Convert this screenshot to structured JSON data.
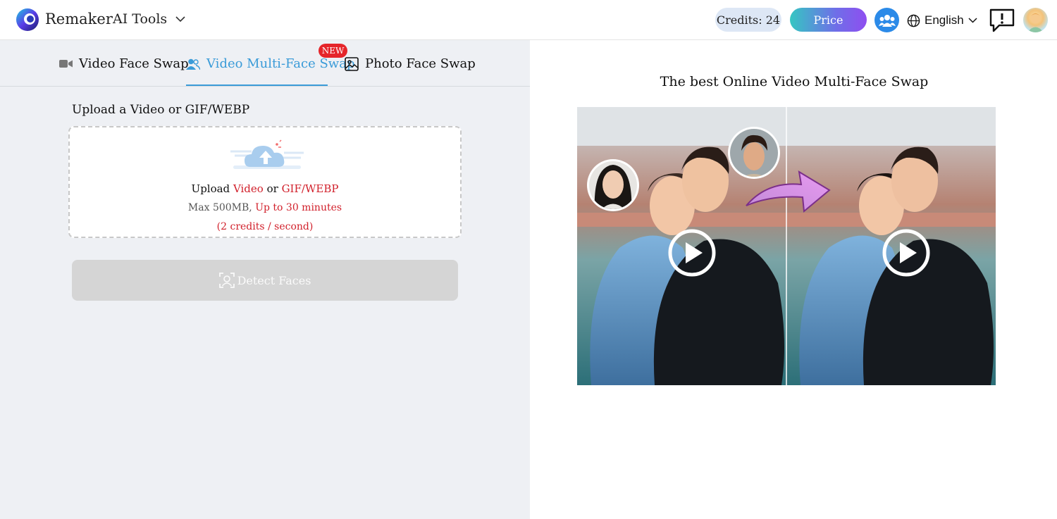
{
  "header": {
    "brand": "Remaker",
    "tools_label": "AI Tools",
    "credits_label": "Credits: 24",
    "price_label": "Price",
    "language": "English"
  },
  "tabs": [
    {
      "label": "Video Face Swap",
      "icon": "video-camera-icon"
    },
    {
      "label": "Video Multi-Face Swap",
      "icon": "users-icon",
      "active": true,
      "badge": "NEW"
    },
    {
      "label": "Photo Face Swap",
      "icon": "image-icon"
    }
  ],
  "upload": {
    "title": "Upload a Video or GIF/WEBP",
    "line1_prefix": "Upload ",
    "line1_video": "Video",
    "line1_or": " or ",
    "line1_gif": "GIF/WEBP",
    "max_size": "Max 500MB",
    "sep": ", ",
    "duration": "Up to 30 minutes",
    "cost": "(2 credits / second)"
  },
  "detect_button": "Detect Faces",
  "preview": {
    "title": "The best Online Video Multi-Face Swap"
  },
  "colors": {
    "accent": "#3a9bd8",
    "badge": "#e5252a",
    "warning_text": "#d11f2a",
    "left_bg": "#eef0f4"
  }
}
